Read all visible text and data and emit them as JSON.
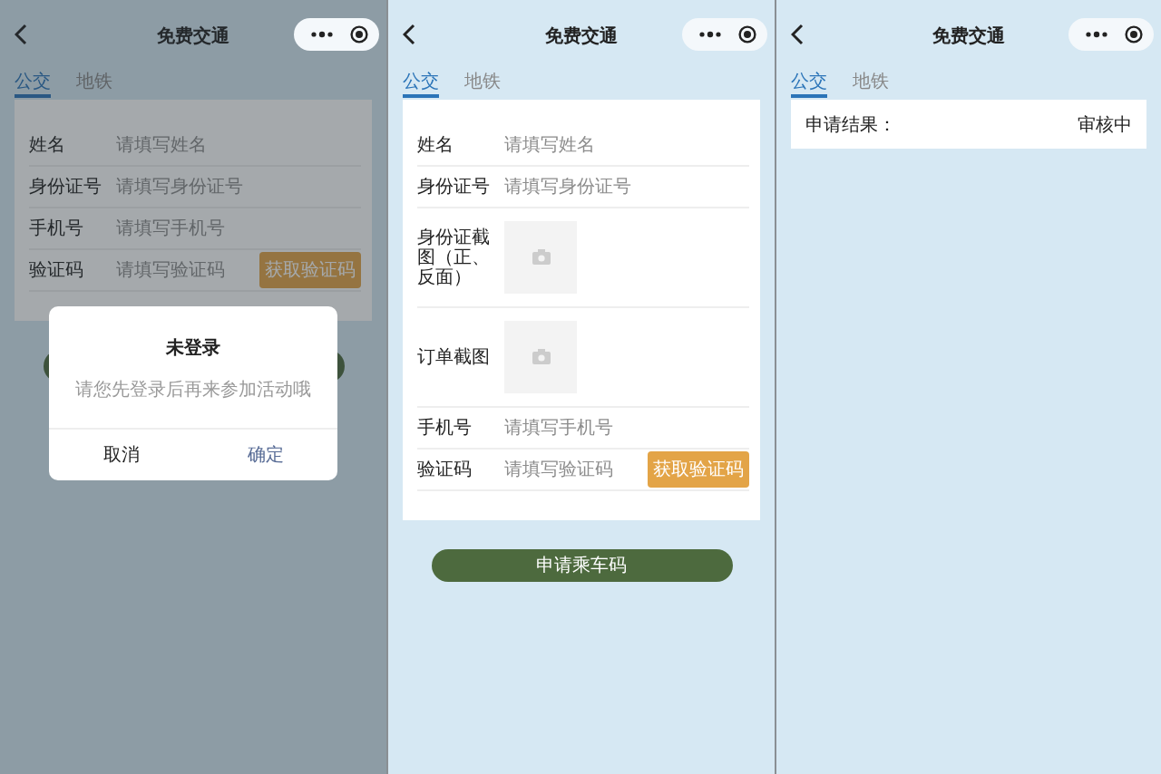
{
  "screens": [
    {
      "kind": "form",
      "nav": {
        "title": "免费交通"
      },
      "tabs": [
        {
          "label": "公交",
          "selected": true
        },
        {
          "label": "地铁",
          "selected": false
        }
      ],
      "rows": [
        {
          "kind": "text",
          "label": "姓名",
          "placeholder": "请填写姓名"
        },
        {
          "kind": "text",
          "label": "身份证号",
          "placeholder": "请填写身份证号"
        },
        {
          "kind": "text",
          "label": "手机号",
          "placeholder": "请填写手机号"
        },
        {
          "kind": "code",
          "label": "验证码",
          "placeholder": "请填写验证码",
          "action": "获取验证码"
        }
      ],
      "dialog": {
        "title": "未登录",
        "message": "请您先登录后再来参加活动哦",
        "buttons": [
          {
            "label": "取消",
            "kind": "cancel"
          },
          {
            "label": "确定",
            "kind": "confirm"
          }
        ]
      }
    },
    {
      "kind": "form",
      "nav": {
        "title": "免费交通"
      },
      "tabs": [
        {
          "label": "公交",
          "selected": true
        },
        {
          "label": "地铁",
          "selected": false
        }
      ],
      "rows": [
        {
          "kind": "text",
          "label": "姓名",
          "placeholder": "请填写姓名"
        },
        {
          "kind": "text",
          "label": "身份证号",
          "placeholder": "请填写身份证号"
        },
        {
          "kind": "photo",
          "label": "身份证截图（正、反面）"
        },
        {
          "kind": "photo",
          "label": "订单截图"
        },
        {
          "kind": "text",
          "label": "手机号",
          "placeholder": "请填写手机号"
        },
        {
          "kind": "code",
          "label": "验证码",
          "placeholder": "请填写验证码",
          "action": "获取验证码"
        }
      ],
      "submit_label": "申请乘车码"
    },
    {
      "kind": "result",
      "nav": {
        "title": "免费交通"
      },
      "tabs": [
        {
          "label": "公交",
          "selected": true
        },
        {
          "label": "地铁",
          "selected": false
        }
      ],
      "result": {
        "label": "申请结果：",
        "value": "审核中"
      }
    }
  ]
}
